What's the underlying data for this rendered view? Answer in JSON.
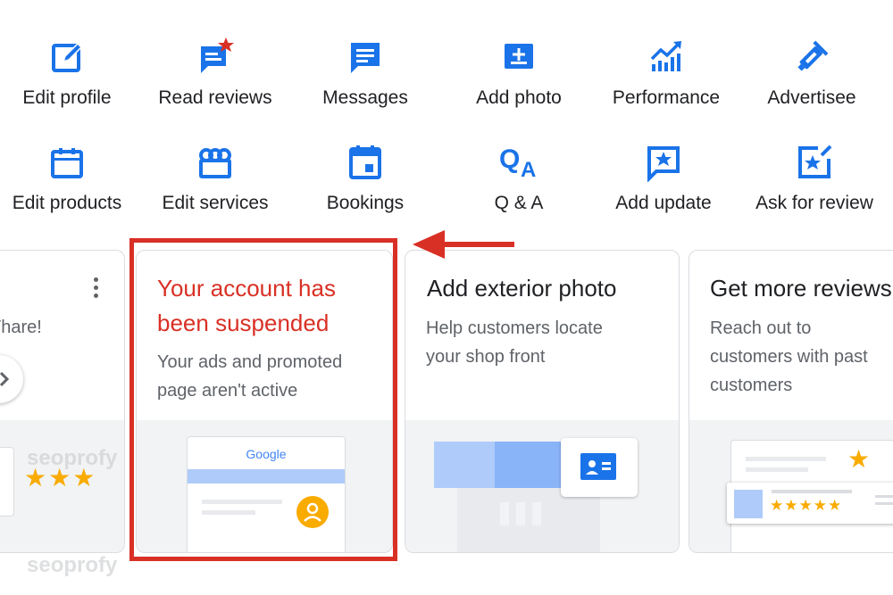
{
  "quick_actions": [
    {
      "label": "Edit profile",
      "icon": "edit-icon"
    },
    {
      "label": "Read reviews",
      "icon": "reviews-star-icon"
    },
    {
      "label": "Messages",
      "icon": "message-icon"
    },
    {
      "label": "Add photo",
      "icon": "add-photo-icon"
    },
    {
      "label": "Performance",
      "icon": "performance-chart-icon"
    },
    {
      "label": "Advertisee",
      "icon": "advertise-icon"
    },
    {
      "label": "Edit products",
      "icon": "products-icon"
    },
    {
      "label": "Edit services",
      "icon": "services-icon"
    },
    {
      "label": "Bookings",
      "icon": "calendar-icon"
    },
    {
      "label": "Q & A",
      "icon": "qa-icon"
    },
    {
      "label": "Add update",
      "icon": "add-update-icon"
    },
    {
      "label": "Ask for review",
      "icon": "ask-review-icon"
    }
  ],
  "cards": {
    "partial": {
      "text": "Thare!"
    },
    "suspended": {
      "title_line1": "Your account has",
      "title_line2": "been suspended",
      "sub_line1": "Your ads and promoted",
      "sub_line2": "page aren't active",
      "illustration_brand": "Google"
    },
    "exterior": {
      "title": "Add exterior photo",
      "sub_line1": "Help customers locate",
      "sub_line2": "your shop front"
    },
    "reviews": {
      "title": "Get more reviews",
      "sub_line1": "Reach out to",
      "sub_line2": "customers with past",
      "sub_line3": "customers"
    }
  },
  "watermark": "seoprofy",
  "colors": {
    "accent": "#1a73e8",
    "alert": "#d93025",
    "star": "#f9ab00"
  }
}
